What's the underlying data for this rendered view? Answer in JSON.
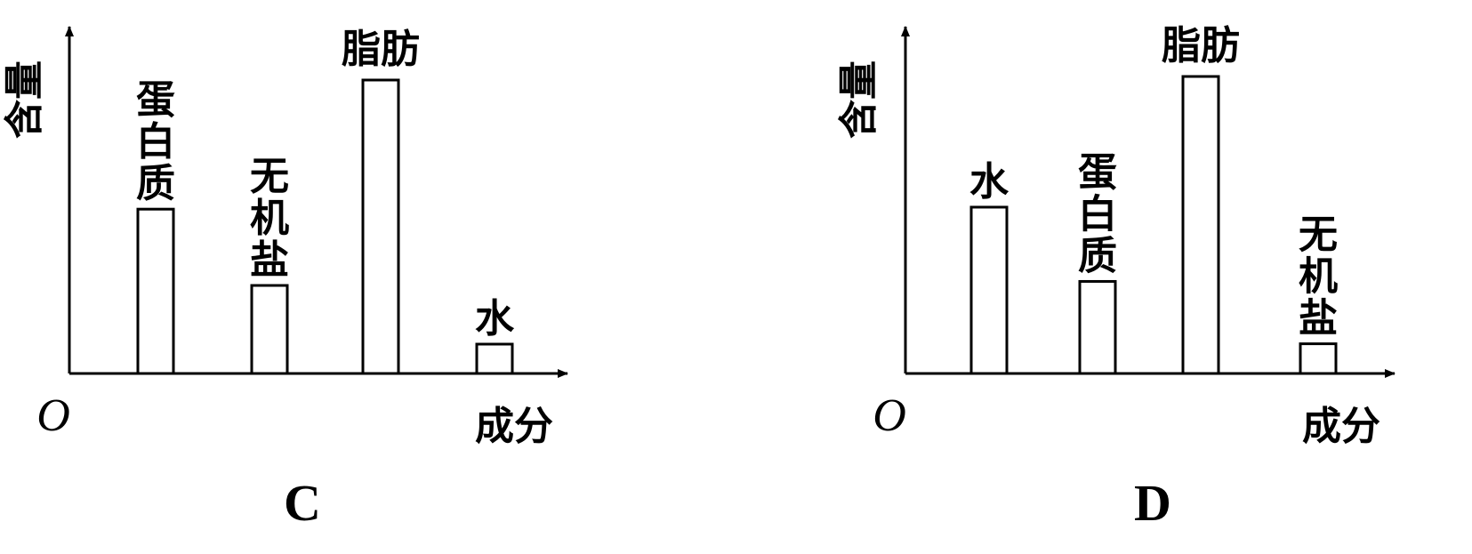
{
  "chart_data": [
    {
      "type": "bar",
      "panel_label": "C",
      "ylabel": "含量",
      "xlabel": "成分",
      "origin": "O",
      "categories": [
        "蛋白质",
        "无机盐",
        "脂肪",
        "水"
      ],
      "values": [
        0.56,
        0.3,
        1.0,
        0.1
      ],
      "ylim": [
        0,
        1.2
      ],
      "grid": false
    },
    {
      "type": "bar",
      "panel_label": "D",
      "ylabel": "含量",
      "xlabel": "成分",
      "origin": "O",
      "categories": [
        "水",
        "蛋白质",
        "脂肪",
        "无机盐"
      ],
      "values": [
        0.56,
        0.31,
        1.0,
        0.1
      ],
      "ylim": [
        0,
        1.2
      ],
      "grid": false
    }
  ]
}
